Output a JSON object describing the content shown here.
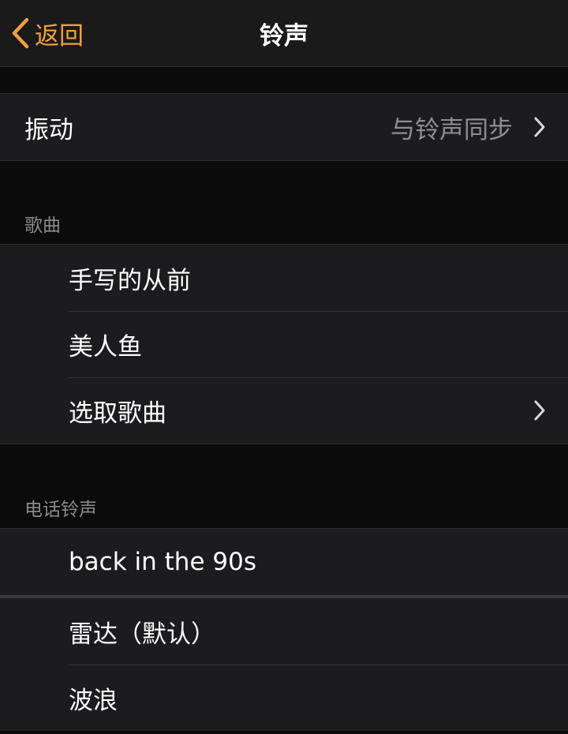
{
  "nav": {
    "back_label": "返回",
    "title": "铃声"
  },
  "vibration": {
    "label": "振动",
    "value": "与铃声同步"
  },
  "songs": {
    "header": "歌曲",
    "items": [
      {
        "label": "手写的从前"
      },
      {
        "label": "美人鱼"
      },
      {
        "label": "选取歌曲"
      }
    ]
  },
  "ringtones": {
    "header": "电话铃声",
    "items": [
      {
        "label": "back in the 90s"
      },
      {
        "label": "雷达（默认）"
      },
      {
        "label": "波浪"
      }
    ]
  },
  "colors": {
    "accent": "#f0a03c",
    "background": "#0b0b0b",
    "cell": "#1c1c1e",
    "secondary_text": "#8e8e93"
  }
}
